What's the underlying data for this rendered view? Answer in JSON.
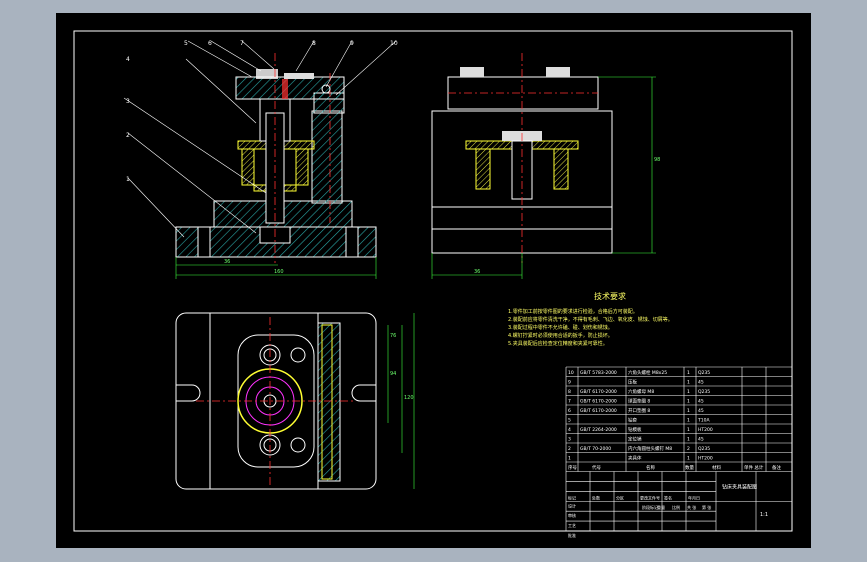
{
  "app_title": "",
  "balloons": [
    "1",
    "2",
    "3",
    "4",
    "5",
    "6",
    "7",
    "8",
    "9",
    "10"
  ],
  "dims": {
    "front_base": "36",
    "front_total": "160",
    "side_width": "36",
    "side_height": "98",
    "top_h1": "76",
    "top_h2": "120",
    "top_h3": "94"
  },
  "notes": {
    "title": "技术要求",
    "lines": [
      "1.零件加工前按零件图的要求进行检验，合格后方可装配。",
      "2.装配前应将零件清洗干净，不得有毛刺、飞边、氧化皮、锈蚀、切屑等。",
      "3.装配过程中零件不允许磕、碰、划伤和锈蚀。",
      "4.螺钉拧紧时必须使用合适的扳手，防止损坏。",
      "5.夹具装配后应检查定位精度和夹紧可靠性。"
    ]
  },
  "bom": {
    "rows": [
      {
        "no": "10",
        "code": "GB/T 5783-2000",
        "name": "六角头螺栓 M8x25",
        "qty": "1",
        "material": "Q235",
        "note": ""
      },
      {
        "no": "9",
        "code": "",
        "name": "压板",
        "qty": "1",
        "material": "45",
        "note": ""
      },
      {
        "no": "8",
        "code": "GB/T 6170-2000",
        "name": "六角螺母 M8",
        "qty": "1",
        "material": "Q235",
        "note": ""
      },
      {
        "no": "7",
        "code": "GB/T 6170-2000",
        "name": "球面垫圈 8",
        "qty": "1",
        "material": "45",
        "note": ""
      },
      {
        "no": "6",
        "code": "GB/T 6170-2000",
        "name": "开口垫圈 8",
        "qty": "1",
        "material": "45",
        "note": ""
      },
      {
        "no": "5",
        "code": "",
        "name": "钻套",
        "qty": "1",
        "material": "T10A",
        "note": ""
      },
      {
        "no": "4",
        "code": "GB/T 2264-2000",
        "name": "钻模板",
        "qty": "1",
        "material": "HT200",
        "note": ""
      },
      {
        "no": "3",
        "code": "",
        "name": "定位销",
        "qty": "1",
        "material": "45",
        "note": ""
      },
      {
        "no": "2",
        "code": "GB/T 70-2000",
        "name": "内六角圆柱头螺钉 M8",
        "qty": "2",
        "material": "Q235",
        "note": ""
      },
      {
        "no": "1",
        "code": "",
        "name": "夹具体",
        "qty": "1",
        "material": "HT200",
        "note": ""
      }
    ],
    "header": {
      "no": "序号",
      "code": "代号",
      "name": "名称",
      "qty": "数量",
      "material": "材料",
      "weight": "单件 总计",
      "note": "备注"
    }
  },
  "title_block": {
    "drawing_name": "钻床夹具装配图",
    "scale": "1:1",
    "labels": [
      "标记",
      "处数",
      "分区",
      "更改文件号",
      "签名",
      "年月日",
      "设计",
      "审核",
      "工艺",
      "批准",
      "阶段标记",
      "重量",
      "比例",
      "共 张",
      "第 张"
    ]
  },
  "colors": {
    "background_outer": "#a9b3bf",
    "drawing_bg": "#000000",
    "outline": "#ffffff",
    "hatch": "#2aa6a6",
    "dimension": "#3cff3c",
    "centerline": "#ff3030",
    "yellow_parts": "#ffff33",
    "magenta": "#ff33ff"
  }
}
